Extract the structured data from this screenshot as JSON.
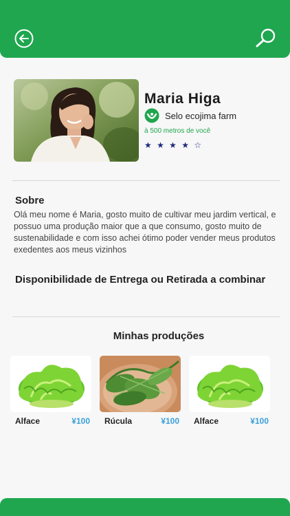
{
  "colors": {
    "brand": "#1fa64f",
    "stars": "#1e2a7a",
    "price": "#3aa0d8"
  },
  "header": {
    "back_icon": "back-arrow-icon",
    "search_icon": "search-icon"
  },
  "profile": {
    "name": "Maria Higa",
    "seal_label": "Selo ecojima farm",
    "distance": "à 500 metros de você",
    "rating": 4,
    "rating_text": "★ ★ ★ ★ ☆"
  },
  "about": {
    "title": "Sobre",
    "text": "Olá meu nome é Maria, gosto muito de cultivar meu jardim vertical, e possuo uma produção maior que a que consumo, gosto muito de sustenabilidade e com isso achei ótimo poder vender meus produtos exedentes aos meus vizinhos",
    "delivery": "Disponibilidade de Entrega ou Retirada a combinar"
  },
  "productions": {
    "title": "Minhas produções",
    "items": [
      {
        "name": "Alface",
        "price": "¥100",
        "icon": "lettuce"
      },
      {
        "name": "Rúcula",
        "price": "¥100",
        "icon": "arugula"
      },
      {
        "name": "Alface",
        "price": "¥100",
        "icon": "lettuce"
      }
    ]
  }
}
